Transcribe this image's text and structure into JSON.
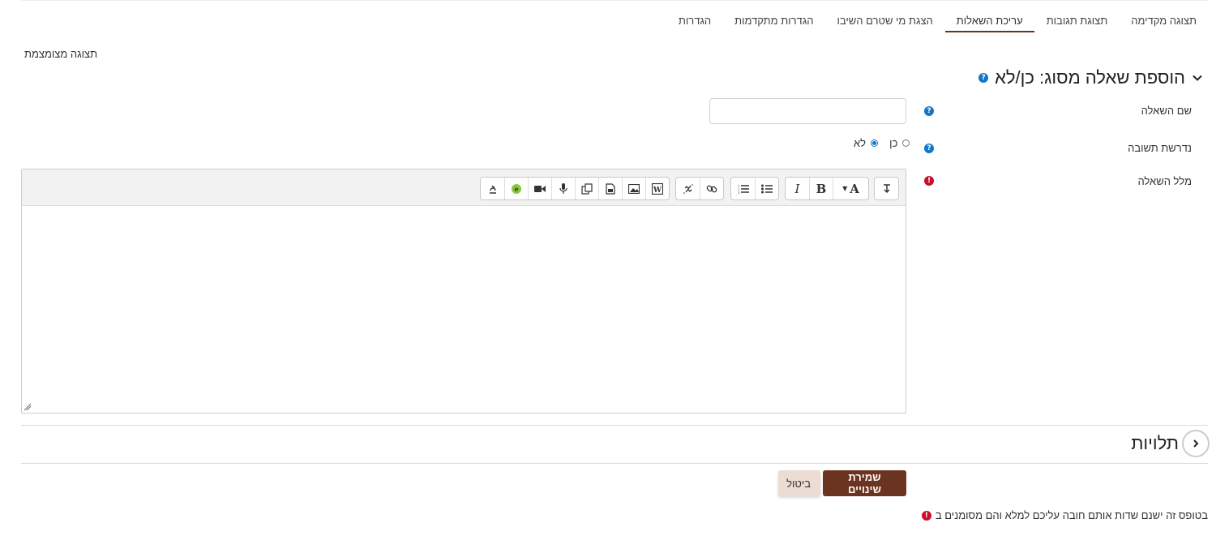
{
  "tabs": [
    {
      "label": "תצוגה מקדימה",
      "active": false
    },
    {
      "label": "תצוגת תגובות",
      "active": false
    },
    {
      "label": "עריכת השאלות",
      "active": true
    },
    {
      "label": "הצגת מי שטרם השיבו",
      "active": false
    },
    {
      "label": "הגדרות מתקדמות",
      "active": false
    },
    {
      "label": "הגדרות",
      "active": false
    }
  ],
  "compact_view": "תצוגה מצומצמת",
  "section": {
    "title": "הוספת שאלה מסוג: כן/לא"
  },
  "form": {
    "question_name_label": "שם השאלה",
    "question_name_value": "",
    "required_label": "נדרשת תשובה",
    "required_options": [
      {
        "label": "כן",
        "checked": false
      },
      {
        "label": "לא",
        "checked": true
      }
    ],
    "question_text_label": "מלל השאלה"
  },
  "editor_toolbar": {
    "icons": [
      "expand-icon",
      "font-color-icon",
      "bold-icon",
      "italic-icon",
      "bullet-list-icon",
      "numbered-list-icon",
      "link-icon",
      "unlink-icon",
      "word-import-icon",
      "image-icon",
      "media-icon",
      "manage-files-icon",
      "record-audio-icon",
      "record-video-icon",
      "h5p-icon",
      "accessibility-icon"
    ],
    "bold": "B",
    "italic": "I",
    "font": "A"
  },
  "dependencies": {
    "title": "תלויות"
  },
  "buttons": {
    "save": "שמירת שינויים",
    "cancel": "ביטול"
  },
  "required_note": "בטופס זה ישנם שדות אותם חובה עליכם למלא והם מסומנים ב",
  "colors": {
    "primary": "#6b3420",
    "cancel_bg": "#ecdcd4",
    "help": "#1177c9",
    "required": "#c8102e"
  }
}
